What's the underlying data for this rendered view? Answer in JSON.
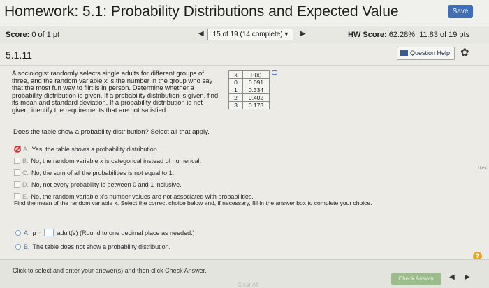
{
  "header": {
    "title": "Homework: 5.1: Probability Distributions and Expected Value",
    "save_label": "Save"
  },
  "score_bar": {
    "score_label": "Score:",
    "score_value": "0 of 1 pt",
    "question_count": "15 of 19 (14 complete) ▾",
    "hw_score_label": "HW Score:",
    "hw_score_value": "62.28%, 11.83 of 19 pts"
  },
  "question_bar": {
    "number": "5.1.11",
    "help_label": "Question Help"
  },
  "problem": {
    "text": "A sociologist randomly selects single adults for different groups of three, and the random variable x is the number in the group who say that the most fun way to flirt is in person. Determine whether a probability distribution is given. If a probability distribution is given, find its mean and standard deviation. If a probability distribution is not given, identify the requirements that are not satisfied.",
    "table": {
      "headers": [
        "x",
        "P(x)"
      ],
      "rows": [
        [
          "0",
          "0.091"
        ],
        [
          "1",
          "0.334"
        ],
        [
          "2",
          "0.402"
        ],
        [
          "3",
          "0.173"
        ]
      ]
    }
  },
  "part1": {
    "prompt": "Does the table show a probability distribution? Select all that apply.",
    "options": [
      {
        "letter": "A.",
        "text": "Yes, the table shows a probability distribution."
      },
      {
        "letter": "B.",
        "text": "No, the random variable x is categorical instead of numerical."
      },
      {
        "letter": "C.",
        "text": "No, the sum of all the probabilities is not equal to 1."
      },
      {
        "letter": "D.",
        "text": "No, not every probability is between 0 and 1 inclusive."
      },
      {
        "letter": "E.",
        "text": "No, the random variable x's number values are not associated with probabilities."
      }
    ]
  },
  "part2": {
    "prompt": "Find the mean of the random variable x. Select the correct choice below and, if necessary, fill in the answer box to complete your choice.",
    "option_a_letter": "A.",
    "option_a_mu": "μ =",
    "option_a_text": "adult(s) (Round to one decimal place as needed.)",
    "option_a_input_value": "",
    "option_b_letter": "B.",
    "option_b_text": "The table does not show a probability distribution."
  },
  "footer": {
    "instruction": "Click to select and enter your answer(s) and then click Check Answer.",
    "clear_all": "Clear All",
    "check_answer": "Check Answer",
    "help_mark": "?"
  },
  "edge_text": "rrec",
  "colors": {
    "save_button": "#3d6fb8",
    "check_button": "#9cbc8e",
    "wrong_mark": "#d43a3a",
    "help_circle": "#e3a82b"
  },
  "icons": [
    "triangle-left-icon",
    "triangle-right-icon",
    "list-icon",
    "gear-icon",
    "copy-icon",
    "wrong-answer-icon",
    "help-circle-icon"
  ]
}
